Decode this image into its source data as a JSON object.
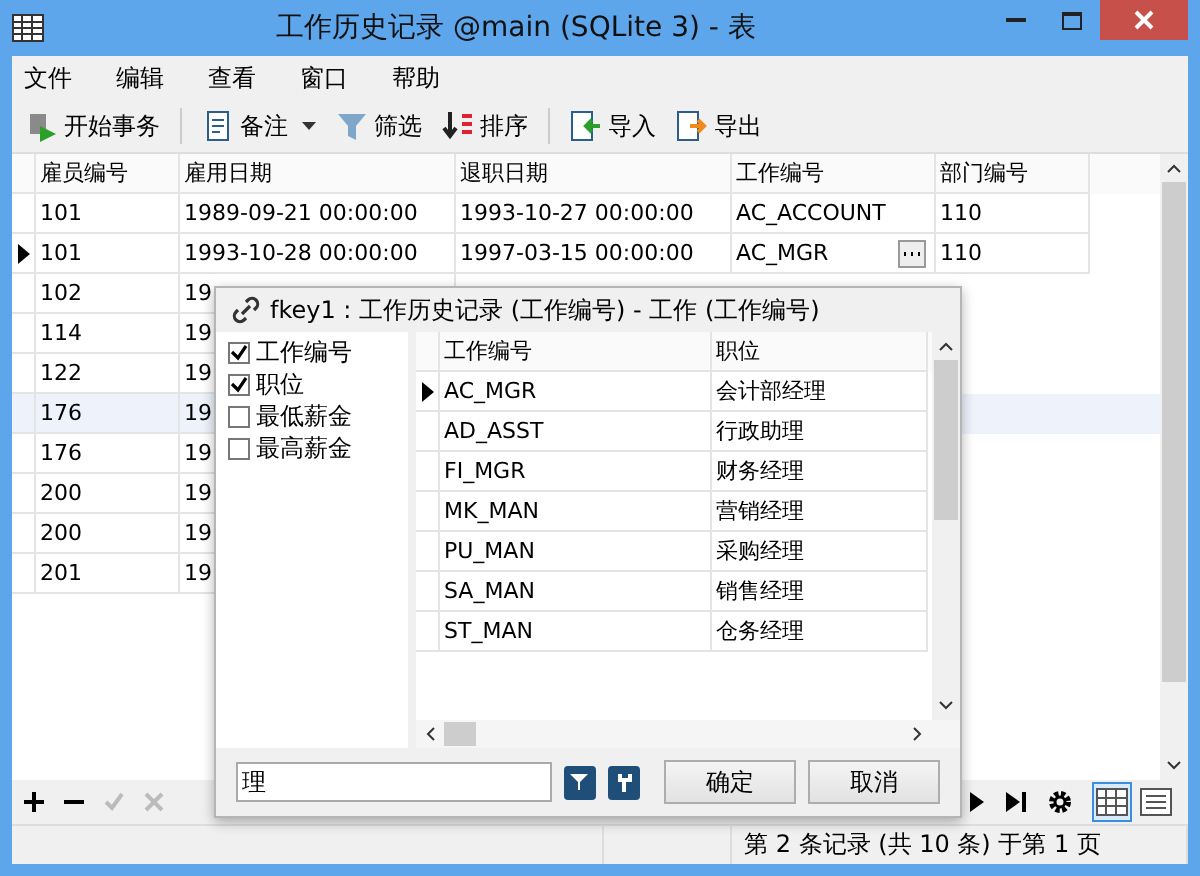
{
  "window": {
    "title": "工作历史记录 @main (SQLite 3) - 表"
  },
  "menu": [
    "文件",
    "编辑",
    "查看",
    "窗口",
    "帮助"
  ],
  "toolbar": [
    {
      "label": "开始事务",
      "kind": "transaction"
    },
    {
      "label": "备注",
      "kind": "memo"
    },
    {
      "label": "筛选",
      "kind": "filter"
    },
    {
      "label": "排序",
      "kind": "sort"
    },
    {
      "label": "导入",
      "kind": "import"
    },
    {
      "label": "导出",
      "kind": "export"
    }
  ],
  "grid": {
    "columns": [
      "雇员编号",
      "雇用日期",
      "退职日期",
      "工作编号",
      "部门编号"
    ],
    "rows": [
      {
        "cells": [
          "101",
          "1989-09-21 00:00:00",
          "1993-10-27 00:00:00",
          "AC_ACCOUNT",
          "110"
        ],
        "current": false,
        "highlighted": false
      },
      {
        "cells": [
          "101",
          "1993-10-28 00:00:00",
          "1997-03-15 00:00:00",
          "AC_MGR",
          "110"
        ],
        "current": true,
        "highlighted": false
      },
      {
        "cells": [
          "102",
          "19"
        ],
        "current": false,
        "highlighted": false
      },
      {
        "cells": [
          "114",
          "19"
        ],
        "current": false,
        "highlighted": false
      },
      {
        "cells": [
          "122",
          "19"
        ],
        "current": false,
        "highlighted": false
      },
      {
        "cells": [
          "176",
          "19"
        ],
        "current": false,
        "highlighted": true
      },
      {
        "cells": [
          "176",
          "19"
        ],
        "current": false,
        "highlighted": false
      },
      {
        "cells": [
          "200",
          "19"
        ],
        "current": false,
        "highlighted": false
      },
      {
        "cells": [
          "200",
          "19"
        ],
        "current": false,
        "highlighted": false
      },
      {
        "cells": [
          "201",
          "19"
        ],
        "current": false,
        "highlighted": false
      }
    ]
  },
  "dialog": {
    "title": "fkey1 : 工作历史记录 (工作编号) - 工作 (工作编号)",
    "fields": [
      {
        "label": "工作编号",
        "checked": true
      },
      {
        "label": "职位",
        "checked": true
      },
      {
        "label": "最低薪金",
        "checked": false
      },
      {
        "label": "最高薪金",
        "checked": false
      }
    ],
    "lookup": {
      "columns": [
        "工作编号",
        "职位"
      ],
      "rows": [
        {
          "cells": [
            "AC_MGR",
            "会计部经理"
          ],
          "current": true
        },
        {
          "cells": [
            "AD_ASST",
            "行政助理"
          ],
          "current": false
        },
        {
          "cells": [
            "FI_MGR",
            "财务经理"
          ],
          "current": false
        },
        {
          "cells": [
            "MK_MAN",
            "营销经理"
          ],
          "current": false
        },
        {
          "cells": [
            "PU_MAN",
            "采购经理"
          ],
          "current": false
        },
        {
          "cells": [
            "SA_MAN",
            "销售经理"
          ],
          "current": false
        },
        {
          "cells": [
            "ST_MAN",
            "仓务经理"
          ],
          "current": false
        }
      ]
    },
    "search": {
      "value": "理"
    },
    "buttons": [
      "确定",
      "取消"
    ]
  },
  "views": [
    {
      "kind": "grid",
      "selected": true
    },
    {
      "kind": "form",
      "selected": false
    }
  ],
  "status_bar": "第 2 条记录 (共 10 条) 于第 1 页"
}
